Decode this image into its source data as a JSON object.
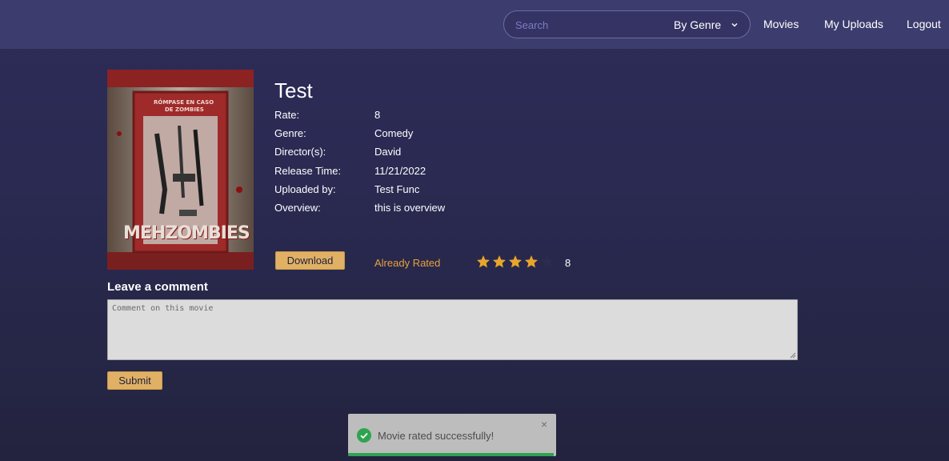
{
  "nav": {
    "search_placeholder": "Search",
    "genre_filter": "By Genre",
    "links": [
      "Movies",
      "My Uploads",
      "Logout"
    ]
  },
  "movie": {
    "title": "Test",
    "poster": {
      "top_text_line1": "RÓMPASE EN CASO",
      "top_text_line2": "DE ZOMBIES",
      "logo_text": "MEHZOMBIES"
    },
    "details": [
      {
        "label": "Rate:",
        "value": "8"
      },
      {
        "label": "Genre:",
        "value": "Comedy"
      },
      {
        "label": "Director(s):",
        "value": "David"
      },
      {
        "label": "Release Time:",
        "value": "11/21/2022"
      },
      {
        "label": "Uploaded by:",
        "value": "Test Func"
      },
      {
        "label": "Overview:",
        "value": "this is overview"
      }
    ]
  },
  "actions": {
    "download_label": "Download",
    "already_rated_label": "Already Rated",
    "rating_value": "8",
    "stars_filled": 4,
    "stars_total": 5
  },
  "comment": {
    "heading": "Leave a comment",
    "placeholder": "Comment on this movie",
    "submit_label": "Submit"
  },
  "toast": {
    "message": "Movie rated successfully!",
    "close_symbol": "×",
    "progress": 0.99
  },
  "colors": {
    "accent_gold": "#e0b165",
    "already_rated": "#e7a23a",
    "star": "#e8a52a",
    "success": "#2ea44f"
  }
}
